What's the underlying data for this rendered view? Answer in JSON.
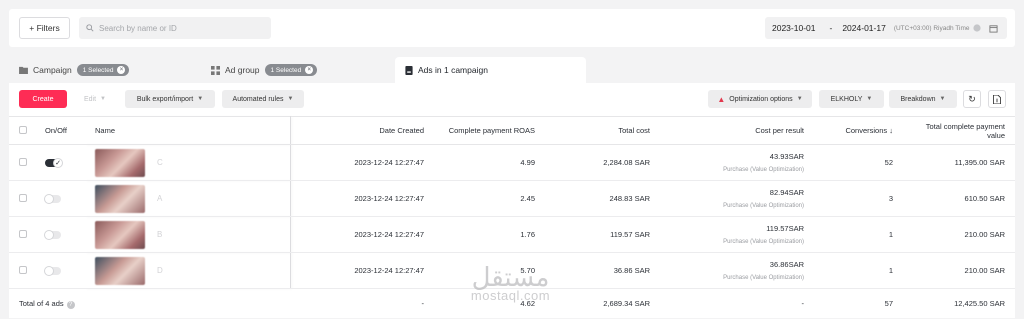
{
  "topbar": {
    "filters_label": "+ Filters",
    "search_placeholder": "Search by name or ID",
    "date_start": "2023-10-01",
    "date_sep": "-",
    "date_end": "2024-01-17",
    "timezone": "(UTC+03:00) Riyadh Time"
  },
  "tabs": [
    {
      "label": "Campaign",
      "badge": "1 Selected"
    },
    {
      "label": "Ad group",
      "badge": "1 Selected"
    },
    {
      "label": "Ads in 1 campaign"
    }
  ],
  "toolbar": {
    "create": "Create",
    "edit": "Edit",
    "bulk": "Bulk export/import",
    "rules": "Automated rules",
    "optimization": "Optimization options",
    "account": "ELKHOLY",
    "breakdown": "Breakdown"
  },
  "columns": {
    "onoff": "On/Off",
    "name": "Name",
    "date": "Date Created",
    "roas": "Complete payment ROAS",
    "cost": "Total cost",
    "cpr": "Cost per result",
    "conv": "Conversions ↓",
    "tcpv": "Total complete payment value"
  },
  "rows": [
    {
      "name": "C",
      "on": true,
      "date": "2023-12-24 12:27:47",
      "roas": "4.99",
      "cost": "2,284.08 SAR",
      "cpr": "43.93SAR",
      "cpr_sub": "Purchase (Value Optimization)",
      "conv": "52",
      "tcpv": "11,395.00 SAR"
    },
    {
      "name": "A",
      "on": false,
      "date": "2023-12-24 12:27:47",
      "roas": "2.45",
      "cost": "248.83 SAR",
      "cpr": "82.94SAR",
      "cpr_sub": "Purchase (Value Optimization)",
      "conv": "3",
      "tcpv": "610.50 SAR"
    },
    {
      "name": "B",
      "on": false,
      "date": "2023-12-24 12:27:47",
      "roas": "1.76",
      "cost": "119.57 SAR",
      "cpr": "119.57SAR",
      "cpr_sub": "Purchase (Value Optimization)",
      "conv": "1",
      "tcpv": "210.00 SAR"
    },
    {
      "name": "D",
      "on": false,
      "date": "2023-12-24 12:27:47",
      "roas": "5.70",
      "cost": "36.86 SAR",
      "cpr": "36.86SAR",
      "cpr_sub": "Purchase (Value Optimization)",
      "conv": "1",
      "tcpv": "210.00 SAR"
    }
  ],
  "total": {
    "label": "Total of 4 ads",
    "date": "-",
    "roas": "4.62",
    "cost": "2,689.34 SAR",
    "cpr": "-",
    "conv": "57",
    "tcpv": "12,425.50 SAR"
  },
  "watermark": {
    "arabic": "مستقل",
    "latin": "mostaql.com"
  },
  "colors": {
    "accent": "#fe2c55",
    "warning": "#e2384d"
  }
}
